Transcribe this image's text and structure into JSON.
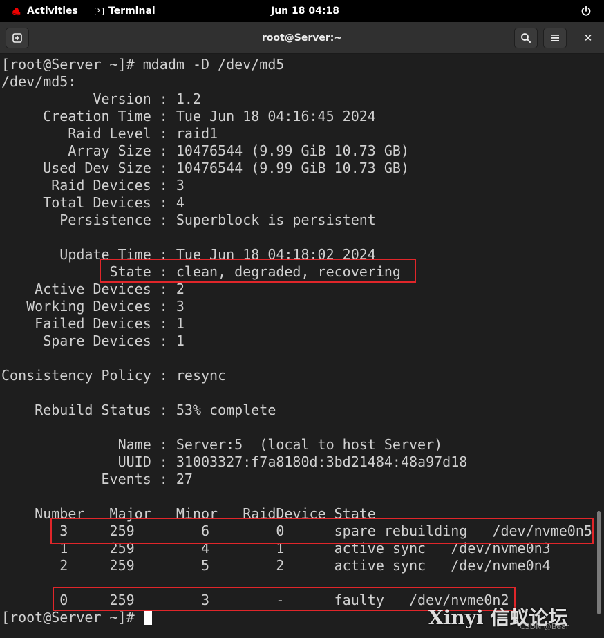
{
  "topbar": {
    "activities_label": "Activities",
    "app_label": "Terminal",
    "clock": "Jun 18  04:18"
  },
  "window": {
    "title": "root@Server:~"
  },
  "terminal": {
    "lines": [
      "[root@Server ~]# mdadm -D /dev/md5",
      "/dev/md5:",
      "           Version : 1.2",
      "     Creation Time : Tue Jun 18 04:16:45 2024",
      "        Raid Level : raid1",
      "        Array Size : 10476544 (9.99 GiB 10.73 GB)",
      "     Used Dev Size : 10476544 (9.99 GiB 10.73 GB)",
      "      Raid Devices : 3",
      "     Total Devices : 4",
      "       Persistence : Superblock is persistent",
      "",
      "       Update Time : Tue Jun 18 04:18:02 2024",
      "             State : clean, degraded, recovering",
      "    Active Devices : 2",
      "   Working Devices : 3",
      "    Failed Devices : 1",
      "     Spare Devices : 1",
      "",
      "Consistency Policy : resync",
      "",
      "    Rebuild Status : 53% complete",
      "",
      "              Name : Server:5  (local to host Server)",
      "              UUID : 31003327:f7a8180d:3bd21484:48a97d18",
      "            Events : 27",
      "",
      "    Number   Major   Minor   RaidDevice State",
      "       3     259        6        0      spare rebuilding   /dev/nvme0n5",
      "       1     259        4        1      active sync   /dev/nvme0n3",
      "       2     259        5        2      active sync   /dev/nvme0n4",
      "",
      "       0     259        3        -      faulty   /dev/nvme0n2"
    ],
    "prompt": "[root@Server ~]# "
  },
  "watermark": {
    "text": "Xinyi 信蚁论坛",
    "sub": "CSDN @Bear"
  },
  "colors": {
    "background": "#1e1e1e",
    "text": "#d0d0d0",
    "highlight": "#e0262a"
  }
}
